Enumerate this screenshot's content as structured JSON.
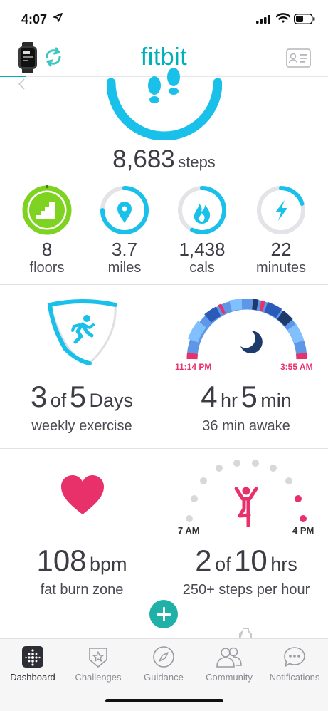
{
  "status_bar": {
    "time": "4:07"
  },
  "header": {
    "logo": "fitbit"
  },
  "steps": {
    "value": "8,683",
    "unit": "steps"
  },
  "stats": [
    {
      "value": "8",
      "label": "floors",
      "icon": "stairs-icon",
      "color": "#7ed321",
      "progress": 1.0
    },
    {
      "value": "3.7",
      "label": "miles",
      "icon": "location-pin-icon",
      "color": "#19c1ea",
      "progress": 0.75
    },
    {
      "value": "1,438",
      "label": "cals",
      "icon": "flame-icon",
      "color": "#19c1ea",
      "progress": 0.55
    },
    {
      "value": "22",
      "label": "minutes",
      "icon": "lightning-icon",
      "color": "#19c1ea",
      "progress": 0.22
    }
  ],
  "exercise": {
    "value": "3",
    "of": "of",
    "goal": "5",
    "unit": "Days",
    "label": "weekly exercise"
  },
  "sleep": {
    "hours": "4",
    "hours_unit": "hr",
    "minutes": "5",
    "minutes_unit": "min",
    "awake": "36 min awake",
    "start": "11:14 PM",
    "end": "3:55 AM"
  },
  "heart": {
    "value": "108",
    "unit": "bpm",
    "label": "fat burn zone"
  },
  "hourly": {
    "value": "2",
    "of": "of",
    "goal": "10",
    "unit": "hrs",
    "label": "250+ steps per hour",
    "start": "7 AM",
    "end": "4 PM"
  },
  "tabs": [
    {
      "label": "Dashboard",
      "icon": "dashboard-icon",
      "active": true
    },
    {
      "label": "Challenges",
      "icon": "challenges-icon",
      "active": false
    },
    {
      "label": "Guidance",
      "icon": "compass-icon",
      "active": false
    },
    {
      "label": "Community",
      "icon": "community-icon",
      "active": false
    },
    {
      "label": "Notifications",
      "icon": "chat-bubble-icon",
      "active": false
    }
  ],
  "colors": {
    "brand": "#00b0b9",
    "accent_blue": "#19c1ea",
    "green": "#7ed321",
    "pink": "#e8306b",
    "navy": "#1d3a6b"
  }
}
